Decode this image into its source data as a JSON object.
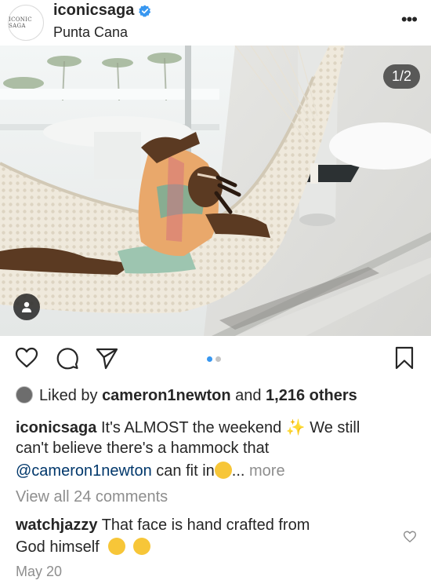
{
  "post": {
    "username": "iconicsaga",
    "location": "Punta Cana",
    "avatar_text": "ICONIC SAGA",
    "more_label": "•••",
    "image_counter": "1/2",
    "carousel_index": 1,
    "carousel_total": 2
  },
  "likes": {
    "prefix": "Liked by",
    "user": "cameron1newton",
    "joiner": "and",
    "others": "1,216 others"
  },
  "caption": {
    "username": "iconicsaga",
    "line1": "It's ALMOST the weekend ✨ We still",
    "line2": "can't believe there's a hammock that",
    "mention": "@cameron1newton",
    "line3_rest": "can fit in",
    "ellipsis": "...",
    "more": "more"
  },
  "comments": {
    "view_all": "View all 24 comments",
    "items": [
      {
        "username": "watchjazzy",
        "text_line1": "That face is hand crafted from",
        "text_line2": "God himself",
        "emojis": [
          "weary-face-emoji",
          "heart-eyes-emoji"
        ]
      }
    ]
  },
  "date": "May 20",
  "icons": {
    "like": "heart-icon",
    "comment": "comment-icon",
    "share": "send-icon",
    "save": "bookmark-icon",
    "verified": "verified-badge-icon",
    "tag": "user-tag-icon"
  },
  "colors": {
    "text": "#262626",
    "muted": "#8e8e8e",
    "link": "#00376b",
    "verified": "#3897f0",
    "dot_active": "#3897f0"
  }
}
